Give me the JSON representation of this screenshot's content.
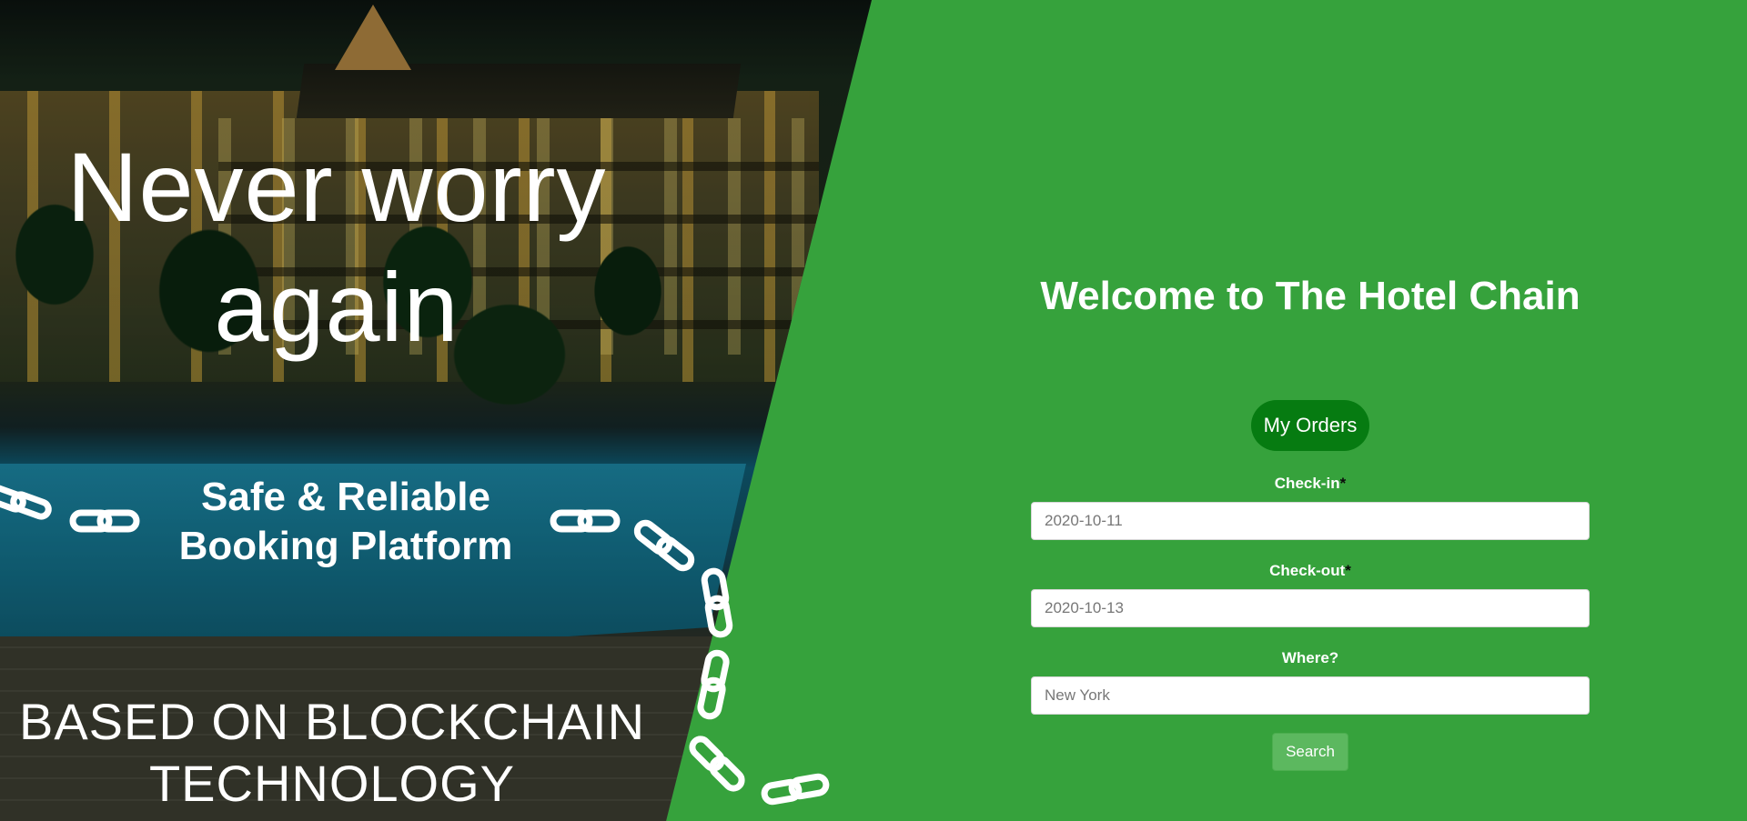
{
  "hero": {
    "headline": "Never worry again",
    "tagline": "Safe & Reliable Booking Platform",
    "technology": "BASED ON BLOCKCHAIN TECHNOLOGY"
  },
  "panel": {
    "welcome": "Welcome to The Hotel Chain",
    "my_orders_label": "My Orders",
    "checkin": {
      "label": "Check-in",
      "required_mark": "*",
      "value": "2020-10-11"
    },
    "checkout": {
      "label": "Check-out",
      "required_mark": "*",
      "value": "2020-10-13"
    },
    "where": {
      "label": "Where?",
      "value": "New York"
    },
    "search_label": "Search"
  },
  "colors": {
    "panel_background": "#36a23c",
    "my_orders_button": "#067b11",
    "search_button": "#5cb85f"
  },
  "icons": [
    "chain-link-icon"
  ]
}
